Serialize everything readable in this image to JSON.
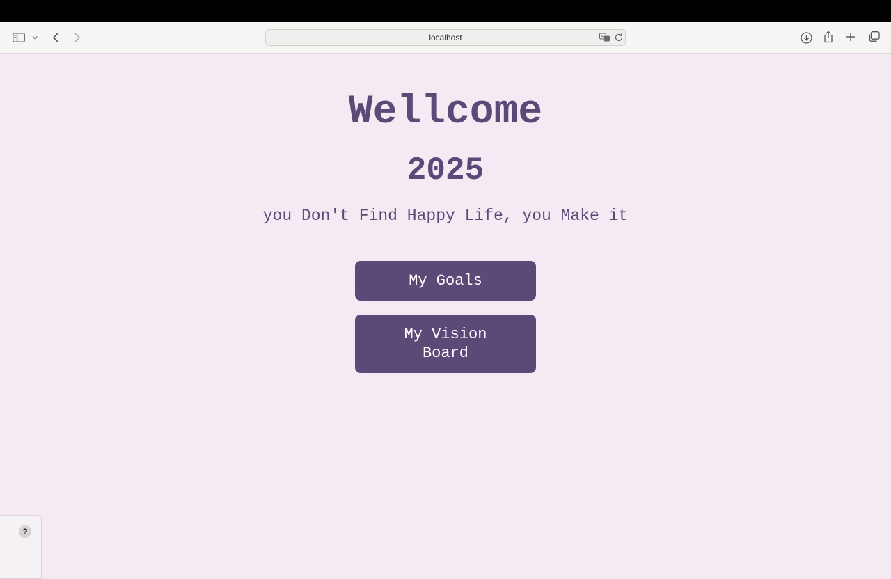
{
  "browser": {
    "url": "localhost",
    "icons": {
      "sidebar": "sidebar-icon",
      "sidebar_menu": "chevron-down-icon",
      "back": "chevron-left-icon",
      "forward": "chevron-right-icon",
      "translate": "translate-icon",
      "reload": "reload-icon",
      "downloads": "download-icon",
      "share": "share-icon",
      "new_tab": "plus-icon",
      "tab_overview": "tabs-icon"
    }
  },
  "page": {
    "title": "Wellcome",
    "year": "2025",
    "tagline": "you Don't Find Happy Life, you Make it",
    "buttons": {
      "goals": "My Goals",
      "vision_board": "My Vision Board"
    },
    "help_label": "?",
    "colors": {
      "background": "#f5e9f4",
      "accent": "#5b4a77",
      "button_text": "#ffffff"
    }
  }
}
